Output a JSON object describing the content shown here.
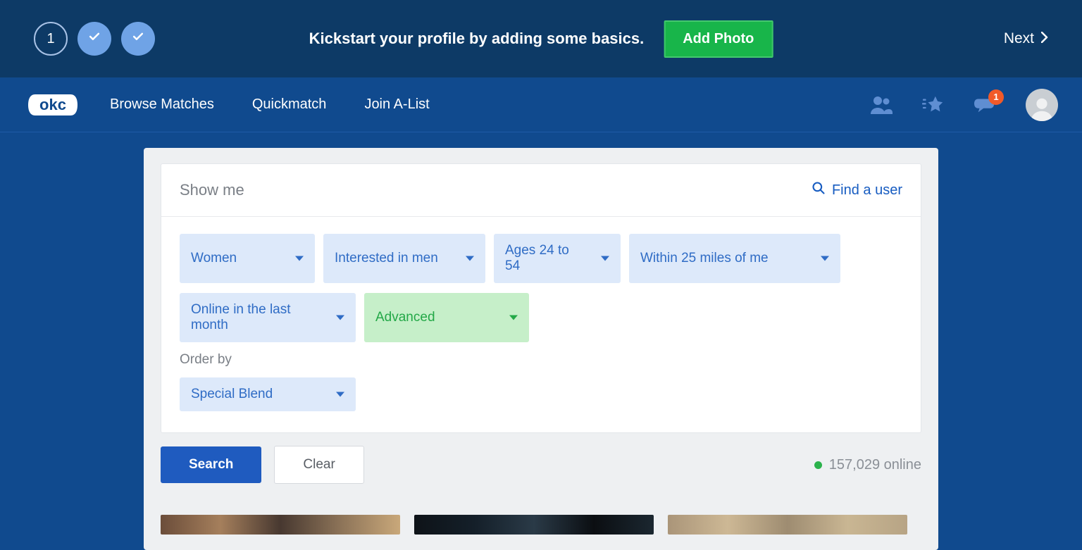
{
  "banner": {
    "step_number": "1",
    "headline": "Kickstart your profile by adding some basics.",
    "add_photo_label": "Add Photo",
    "next_label": "Next"
  },
  "nav": {
    "logo_text": "okc",
    "links": [
      "Browse Matches",
      "Quickmatch",
      "Join A-List"
    ],
    "message_badge": "1"
  },
  "filters": {
    "heading": "Show me",
    "find_user_label": "Find a user",
    "pills": {
      "gender": "Women",
      "interest": "Interested in men",
      "ages": "Ages 24 to 54",
      "distance": "Within 25 miles of me",
      "activity": "Online in the last month",
      "advanced": "Advanced"
    },
    "order_label": "Order by",
    "order_value": "Special Blend"
  },
  "actions": {
    "search_label": "Search",
    "clear_label": "Clear",
    "online_text": "157,029 online"
  }
}
